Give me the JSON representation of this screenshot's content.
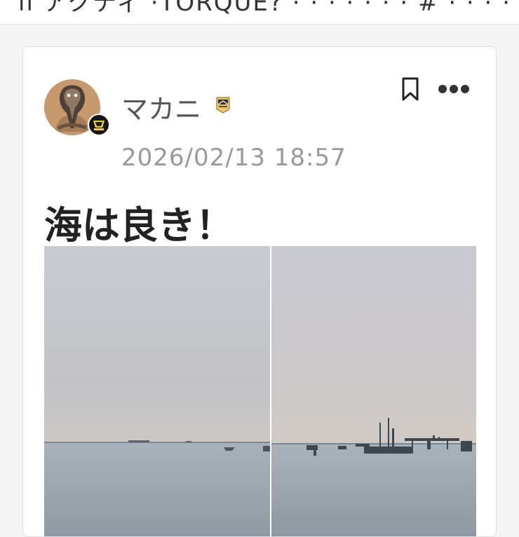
{
  "topbar": {
    "text": "ll アクティ  ·TORQUE?  ·  ·  ·  ·  ·  ·  ·  #  ·  ·  ·  ·  ·  ·  ·  # の  ·  ·  ·  ·  ·  ·  · ・パム  ·  ·  ·  ·  ·  ·  ·  ·  ·  ·  ·  ·  · 列は"
  },
  "post": {
    "username": "マカニ",
    "timestamp": "2026/02/13 18:57",
    "title": "海は良き！",
    "images": [
      "sea-left",
      "sea-right"
    ]
  },
  "icons": {
    "avatar": "cobra-avatar",
    "avatar_badge": "team-badge-icon",
    "user_badge": "user-rank-badge-icon",
    "bookmark": "bookmark-icon",
    "more": "more-options-icon"
  }
}
